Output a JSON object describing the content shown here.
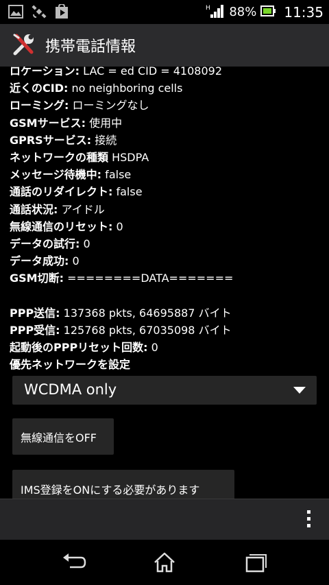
{
  "status": {
    "battery_percent": "88%",
    "time": "11:35",
    "network_indicator": "H"
  },
  "actionbar": {
    "title": "携帯電話情報",
    "icon": "tools-icon"
  },
  "info_rows": [
    {
      "label": "ロケーション:",
      "value": " LAC = ed   CID = 4108092"
    },
    {
      "label": "近くのCID:",
      "value": " no neighboring cells"
    },
    {
      "label": "ローミング:",
      "value": " ローミングなし"
    },
    {
      "label": "GSMサービス:",
      "value": " 使用中"
    },
    {
      "label": "GPRSサービス:",
      "value": " 接続"
    },
    {
      "label": "ネットワークの種類",
      "value": " HSDPA"
    },
    {
      "label": "メッセージ待機中:",
      "value": " false"
    },
    {
      "label": "通話のリダイレクト:",
      "value": " false"
    },
    {
      "label": "通話状況:",
      "value": " アイドル"
    },
    {
      "label": "無線通信のリセット:",
      "value": " 0"
    },
    {
      "label": "データの試行:",
      "value": " 0"
    },
    {
      "label": "データ成功:",
      "value": " 0"
    },
    {
      "label": "GSM切断:",
      "value": " ========DATA======="
    }
  ],
  "ppp_rows": [
    {
      "label": "PPP送信:",
      "value": " 137368 pkts, 64695887 バイト"
    },
    {
      "label": "PPP受信:",
      "value": " 125768 pkts, 67035098 バイト"
    },
    {
      "label": "起動後のPPPリセット回数:",
      "value": " 0"
    }
  ],
  "preferred_network": {
    "label": "優先ネットワークを設定",
    "selected": "WCDMA only"
  },
  "buttons": {
    "radio_off": "無線通信をOFF",
    "ims": "IMS登録をONにする必要があります"
  }
}
